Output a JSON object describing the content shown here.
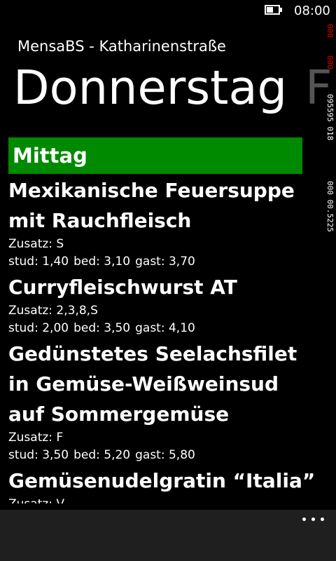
{
  "status": {
    "time": "08:00"
  },
  "debug": {
    "red1": "000",
    "red2": "000",
    "line1": "095595 018",
    "line2": "000 00.5225"
  },
  "app": {
    "title": "MensaBS - Katharinenstraße"
  },
  "pivot": {
    "current": "Donnerstag",
    "next": "F"
  },
  "section": {
    "title": "Mittag"
  },
  "dishes": [
    {
      "name": "Mexikanische Feuersuppe mit Rauchfleisch",
      "extra": "Zusatz: S",
      "stud": "stud: 1,40",
      "bed": "bed: 3,10",
      "gast": "gast: 3,70"
    },
    {
      "name": "Curryfleischwurst AT",
      "extra": "Zusatz: 2,3,8,S",
      "stud": "stud: 2,00",
      "bed": "bed: 3,50",
      "gast": "gast: 4,10"
    },
    {
      "name": "Gedünstetes Seelachsfilet in Gemüse-Weißweinsud auf Sommergemüse",
      "extra": "Zusatz: F",
      "stud": "stud: 3,50",
      "bed": "bed: 5,20",
      "gast": "gast: 5,80"
    },
    {
      "name": "Gemüsenudelgratin “Italia”",
      "extra": "Zusatz: V",
      "stud": "",
      "bed": "",
      "gast": ""
    }
  ],
  "appbar": {
    "icon": "more-icon"
  },
  "colors": {
    "accent": "#008a00",
    "background": "#000000",
    "appbar": "#1f1f1f"
  }
}
